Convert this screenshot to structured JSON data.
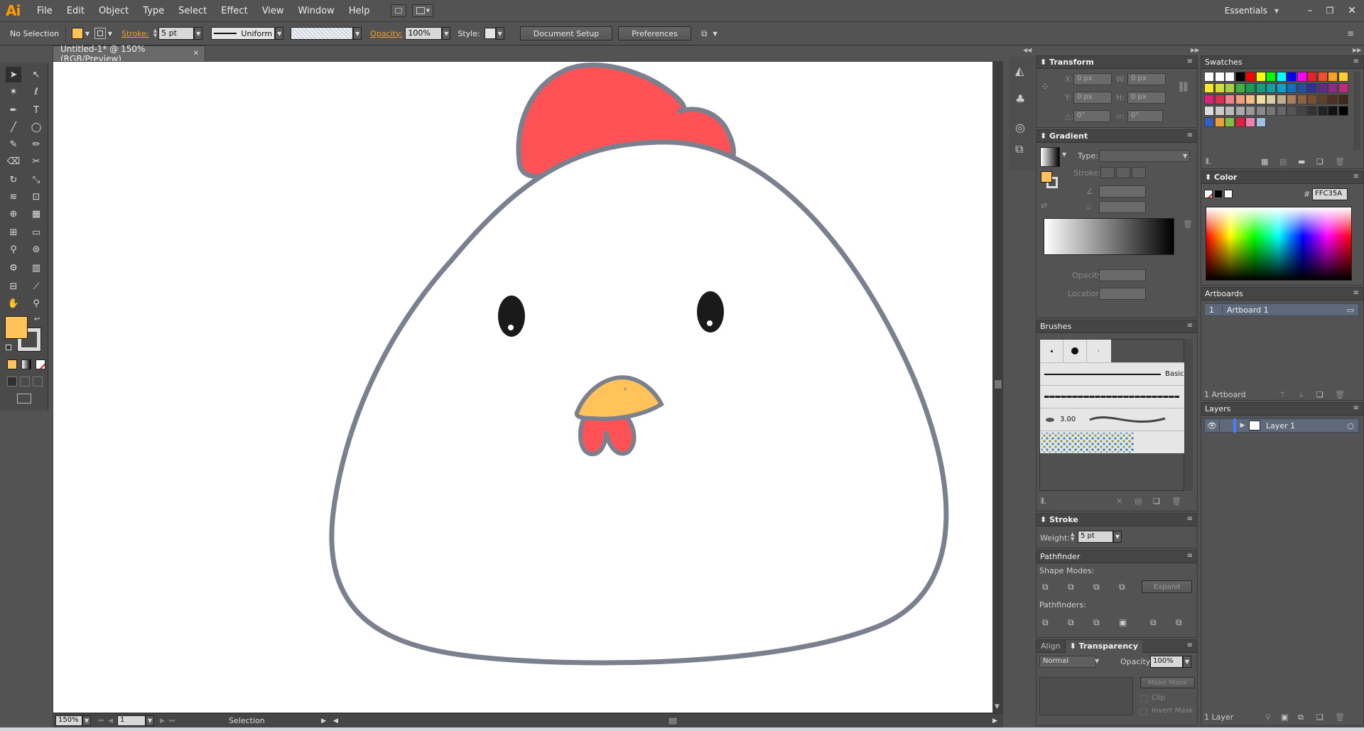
{
  "menu": {
    "logo": "Ai",
    "items": [
      "File",
      "Edit",
      "Object",
      "Type",
      "Select",
      "Effect",
      "View",
      "Window",
      "Help"
    ],
    "workspace": "Essentials"
  },
  "control": {
    "selection_label": "No Selection",
    "stroke_label": "Stroke:",
    "stroke_value": "5 pt",
    "profile_value": "Uniform",
    "opacity_label": "Opacity:",
    "opacity_value": "100%",
    "style_label": "Style:",
    "document_setup": "Document Setup",
    "preferences": "Preferences"
  },
  "document": {
    "tab_title": "Untitled-1* @ 150% (RGB/Preview)",
    "zoom": "150%",
    "artboard_nav": "1",
    "status_tool": "Selection"
  },
  "transform": {
    "title": "Transform",
    "x_label": "X:",
    "x_value": "0 px",
    "y_label": "Y:",
    "y_value": "0 px",
    "w_label": "W:",
    "w_value": "0 px",
    "h_label": "H:",
    "h_value": "0 px",
    "rot_value": "0°",
    "shear_value": "0°"
  },
  "gradient": {
    "title": "Gradient",
    "type_label": "Type:",
    "stroke_label": "Stroke:",
    "opacity_label": "Opacity:",
    "location_label": "Location:"
  },
  "brushes": {
    "title": "Brushes",
    "basic_label": "Basic",
    "size_label": "3.00"
  },
  "stroke": {
    "title": "Stroke",
    "weight_label": "Weight:",
    "weight_value": "5 pt"
  },
  "pathfinder": {
    "title": "Pathfinder",
    "shape_modes_label": "Shape Modes:",
    "pathfinders_label": "Pathfinders:",
    "expand": "Expand"
  },
  "transparency": {
    "align_tab": "Align",
    "title": "Transparency",
    "blend_mode": "Normal",
    "opacity_label": "Opacity:",
    "opacity_value": "100%",
    "make_mask": "Make Mask",
    "clip": "Clip",
    "invert_mask": "Invert Mask"
  },
  "swatches": {
    "title": "Swatches"
  },
  "color": {
    "title": "Color",
    "hex_value": "FFC35A"
  },
  "artboards": {
    "title": "Artboards",
    "items": [
      {
        "num": "1",
        "name": "Artboard 1"
      }
    ],
    "count_label": "1 Artboard"
  },
  "layers": {
    "title": "Layers",
    "items": [
      {
        "name": "Layer 1"
      }
    ],
    "count_label": "1 Layer"
  },
  "colors": {
    "fill": "#ffc35a",
    "comb": "#ff5257",
    "outline": "#7b808e",
    "eye": "#1a1a1a",
    "beak": "#ffc35a"
  }
}
